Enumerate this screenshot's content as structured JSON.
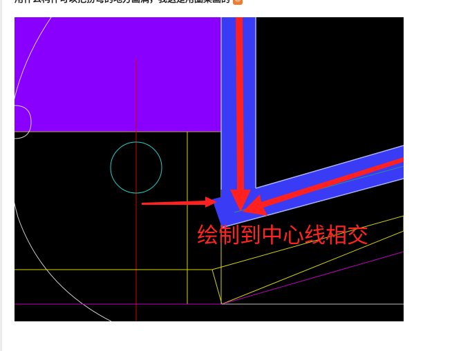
{
  "post": {
    "question_text": "用什么构件可以把扮弯的地方画满，我这是用圈梁画的",
    "emoji_name": "emoji-icon",
    "emoji_glyph": "☺"
  },
  "cad_view": {
    "annotation_text": "绘制到中心线相交",
    "colors": {
      "background": "#000000",
      "purple_region": "#8a00ff",
      "beam_blue": "#3a3cf5",
      "beam_edge": "#a8b4ff",
      "red_arrow": "#ff2020",
      "red_axis": "#d80000",
      "yellow_line": "#d8d800",
      "cyan_circle": "#20d0c8",
      "magenta_line": "#c000c0",
      "white_arc": "#cfcfcf"
    }
  }
}
